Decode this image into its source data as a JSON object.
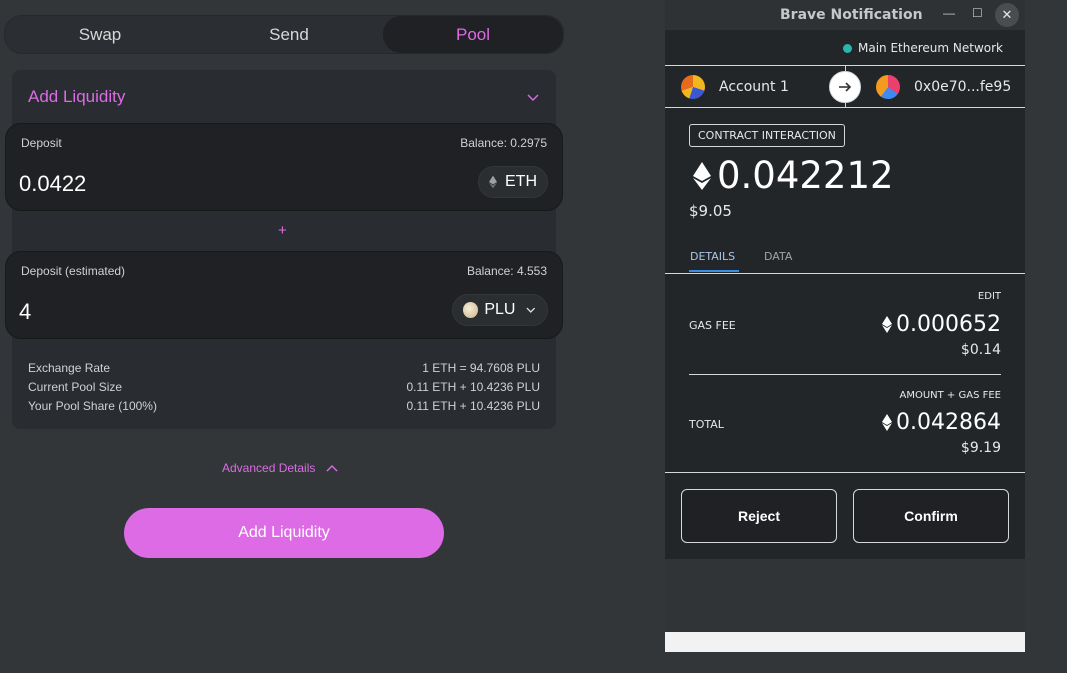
{
  "uniswap": {
    "tabs": [
      {
        "label": "Swap"
      },
      {
        "label": "Send"
      },
      {
        "label": "Pool"
      }
    ],
    "add_liquidity_title": "Add Liquidity",
    "deposit1": {
      "label": "Deposit",
      "balance": "Balance: 0.2975",
      "value": "0.0422",
      "token": "ETH"
    },
    "plus": "+",
    "deposit2": {
      "label": "Deposit (estimated)",
      "balance": "Balance: 4.553",
      "value": "4",
      "token": "PLU"
    },
    "stats": [
      {
        "label": "Exchange Rate",
        "value": "1 ETH = 94.7608 PLU"
      },
      {
        "label": "Current Pool Size",
        "value": "0.11 ETH + 10.4236 PLU"
      },
      {
        "label": "Your Pool Share (100%)",
        "value": "0.11 ETH + 10.4236 PLU"
      }
    ],
    "advanced_details": "Advanced Details",
    "add_button": "Add Liquidity",
    "accent_color": "#dc6be5"
  },
  "notification": {
    "window_title": "Brave Notification",
    "window_controls": {
      "minimize": "—",
      "maximize": "☐",
      "close": "✕"
    },
    "network": "Main Ethereum Network",
    "from_account": "Account 1",
    "to_account": "0x0e70...fe95",
    "badge": "CONTRACT INTERACTION",
    "amount": "0.042212",
    "amount_usd": "$9.05",
    "tabs": [
      {
        "label": "DETAILS"
      },
      {
        "label": "DATA"
      }
    ],
    "edit": "EDIT",
    "gas_fee_label": "GAS FEE",
    "gas_fee_amount": "0.000652",
    "gas_fee_usd": "$0.14",
    "amount_gas_caption": "AMOUNT + GAS FEE",
    "total_label": "TOTAL",
    "total_amount": "0.042864",
    "total_usd": "$9.19",
    "reject": "Reject",
    "confirm": "Confirm",
    "network_color": "#29b6af"
  }
}
